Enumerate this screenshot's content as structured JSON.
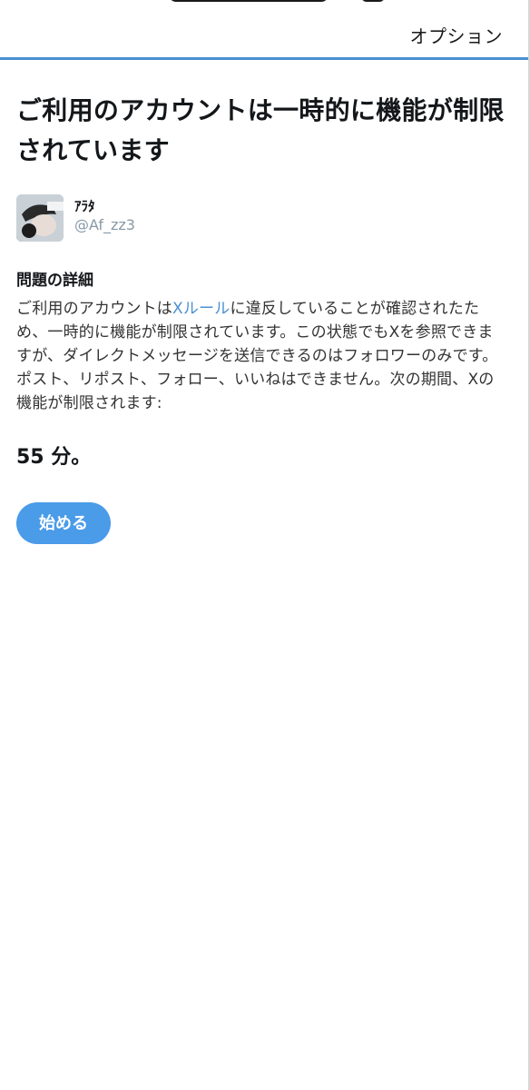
{
  "header": {
    "options_label": "オプション"
  },
  "main": {
    "headline": "ご利用のアカウントは一時的に機能が制限されています",
    "account": {
      "display_name": "ｱﾗﾀ",
      "handle": "@Af_zz3"
    },
    "details": {
      "title": "問題の詳細",
      "body_before_link": "ご利用のアカウントは",
      "rules_link": "Xルール",
      "body_after_link": "に違反していることが確認されたため、一時的に機能が制限されています。この状態でもXを参照できますが、ダイレクトメッセージを送信できるのはフォロワーのみです。ポスト、リポスト、フォロー、いいねはできません。次の期間、Xの機能が制限されます:"
    },
    "duration": "55 分。",
    "start_button_label": "始める"
  },
  "colors": {
    "accent": "#4a90d2",
    "button": "#4a9be8",
    "text": "#14171a",
    "muted": "#8899a6"
  }
}
